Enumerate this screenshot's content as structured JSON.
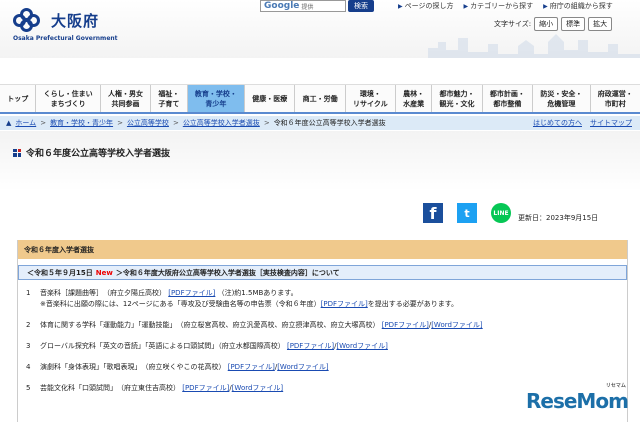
{
  "header": {
    "logo_name": "大阪府",
    "logo_sub": "Osaka Prefectural Government",
    "search_google": "Google",
    "search_provider": "提供",
    "search_button": "検索",
    "top_links": [
      "ページの探し方",
      "カテゴリーから探す",
      "府庁の組織から探す"
    ],
    "text_size_label": "文字サイズ:",
    "text_size_buttons": [
      "縮小",
      "標準",
      "拡大"
    ]
  },
  "nav": [
    {
      "l1": "トップ",
      "l2": ""
    },
    {
      "l1": "くらし・住まい",
      "l2": "まちづくり"
    },
    {
      "l1": "人権・男女",
      "l2": "共同参画"
    },
    {
      "l1": "福祉・",
      "l2": "子育て"
    },
    {
      "l1": "教育・学校・",
      "l2": "青少年"
    },
    {
      "l1": "健康・医療",
      "l2": ""
    },
    {
      "l1": "商工・労働",
      "l2": ""
    },
    {
      "l1": "環境・",
      "l2": "リサイクル"
    },
    {
      "l1": "農林・",
      "l2": "水産業"
    },
    {
      "l1": "都市魅力・",
      "l2": "観光・文化"
    },
    {
      "l1": "都市計画・",
      "l2": "都市整備"
    },
    {
      "l1": "防災・安全・",
      "l2": "危機管理"
    },
    {
      "l1": "府政運営・",
      "l2": "市町村"
    }
  ],
  "breadcrumb": {
    "items": [
      "ホーム",
      "教育・学校・青少年",
      "公立高等学校",
      "公立高等学校入学者選抜"
    ],
    "current": "令和６年度公立高等学校入学者選抜",
    "right_links": [
      "はじめての方へ",
      "サイトマップ"
    ]
  },
  "page_title": "令和６年度公立高等学校入学者選抜",
  "share": {
    "fb": "f",
    "tw": "t",
    "line": "LINE"
  },
  "updated": "更新日：2023年9月15日",
  "section": {
    "heading": "令和６年度入学者選抜",
    "sub_pre": "＜令和５年９月15日",
    "sub_new": "New",
    "sub_post": "＞令和６年度大阪府公立高等学校入学者選抜［実技検査内容］について"
  },
  "items": [
    {
      "num": "1",
      "text": "音楽科［課題曲等］　（府立夕陽丘高校）",
      "pdf": "[PDFファイル]",
      "word": "",
      "tail": "（注)約1.5MBあります。",
      "note_pre": "※音楽科に出願の際には、12ページにある「専攻及び受験曲名等の申告票（令和６年度）",
      "note_link": "[PDFファイル]",
      "note_post": "を提出する必要があります。"
    },
    {
      "num": "2",
      "text": "体育に関する学科「運動能力」「運動技能」　（府立桜宮高校、府立汎愛高校、府立摂津高校、府立大塚高校）",
      "pdf": "[PDFファイル]",
      "word": "[Wordファイル]",
      "tail": "",
      "note_pre": "",
      "note_link": "",
      "note_post": ""
    },
    {
      "num": "3",
      "text": "グローバル探究科「英文の音読」「英語による口頭試問」（府立水都国際高校）",
      "pdf": "[PDFファイル]",
      "word": "[Wordファイル]",
      "tail": "",
      "note_pre": "",
      "note_link": "",
      "note_post": ""
    },
    {
      "num": "4",
      "text": "演劇科「身体表現」「歌唱表現」　（府立咲くやこの花高校）",
      "pdf": "[PDFファイル]",
      "word": "[Wordファイル]",
      "tail": "",
      "note_pre": "",
      "note_link": "",
      "note_post": ""
    },
    {
      "num": "5",
      "text": "芸能文化科「口頭試問」　（府立東住吉高校）",
      "pdf": "[PDFファイル]",
      "word": "[Wordファイル]",
      "tail": "",
      "note_pre": "",
      "note_link": "",
      "note_post": ""
    }
  ],
  "watermark": {
    "text": "ReseMom",
    "ruby": "リセマム"
  },
  "colors": {
    "brand": "#163e8c",
    "active_nav": "#7fbdee",
    "section_head": "#f0c98c",
    "new": "#ee0000",
    "link": "#1a4bb2"
  }
}
